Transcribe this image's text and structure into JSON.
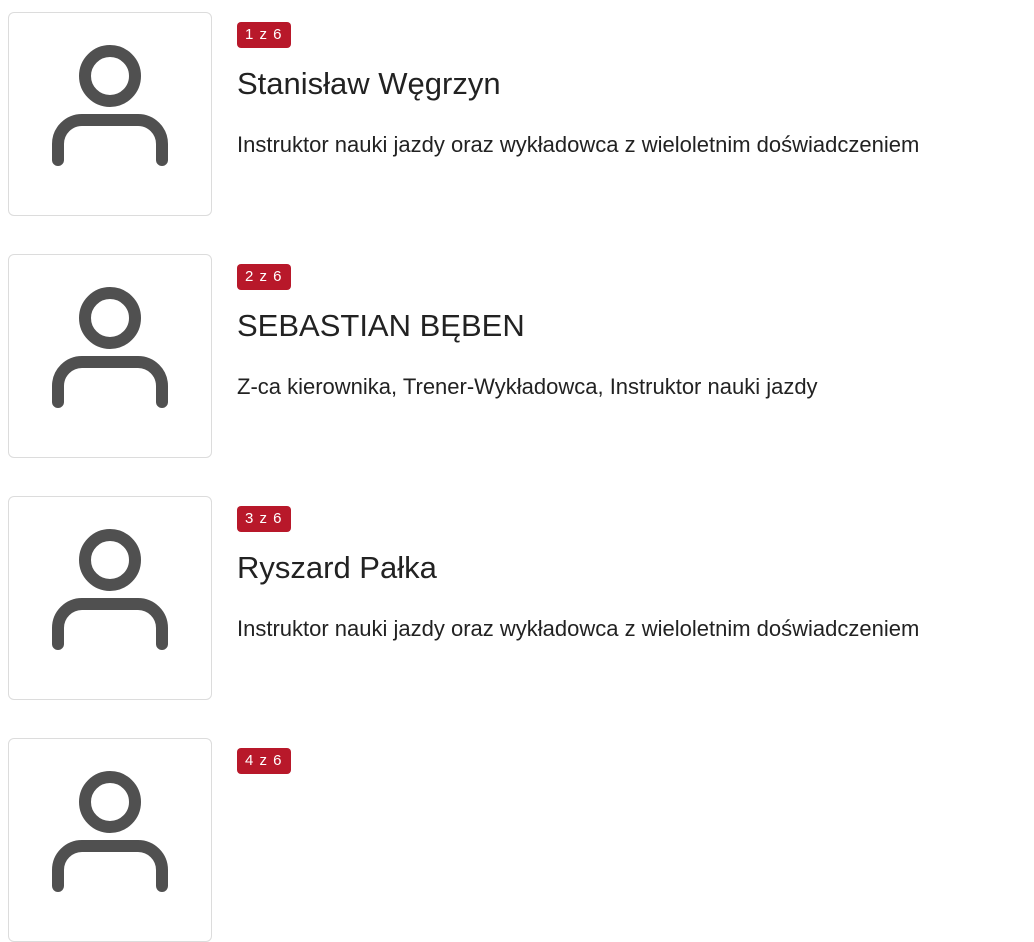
{
  "people": [
    {
      "badge": "1 z 6",
      "name": "Stanisław Węgrzyn",
      "role": "Instruktor nauki jazdy oraz wykładowca z wieloletnim doświadczeniem",
      "icon": "user-icon"
    },
    {
      "badge": "2 z 6",
      "name": "SEBASTIAN BĘBEN",
      "role": "Z-ca kierownika, Trener-Wykładowca, Instruktor nauki jazdy",
      "icon": "user-icon"
    },
    {
      "badge": "3 z 6",
      "name": "Ryszard Pałka",
      "role": "Instruktor nauki jazdy oraz wykładowca z wieloletnim doświadczeniem",
      "icon": "user-icon"
    },
    {
      "badge": "4 z 6",
      "icon": "user-icon"
    }
  ],
  "colors": {
    "badge_bg": "#b8182a",
    "icon": "#505050",
    "border": "#dcdcdc"
  }
}
